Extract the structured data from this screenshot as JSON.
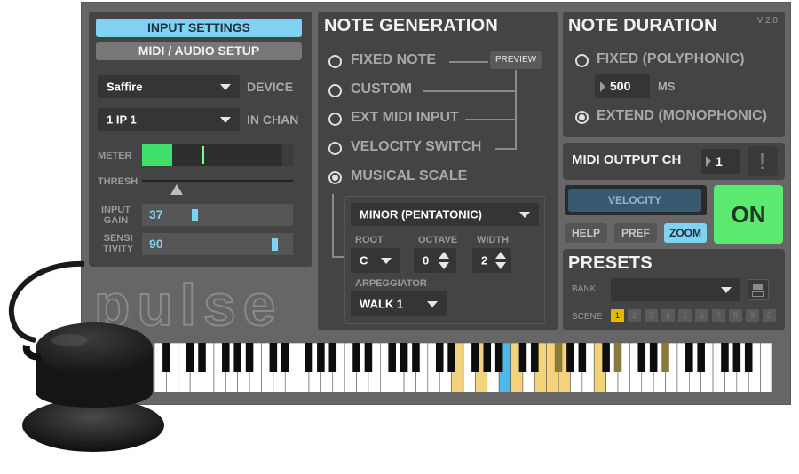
{
  "version": "V 2.0",
  "logo_text": "pulse",
  "input_panel": {
    "tab_input_settings": "INPUT SETTINGS",
    "tab_midi_audio_setup": "MIDI / AUDIO SETUP",
    "device_value": "Saffire",
    "device_label": "DEVICE",
    "in_chan_value": "1 IP 1",
    "in_chan_label": "IN CHAN",
    "meter_label": "METER",
    "meter_level": 0.31,
    "thresh_label": "THRESH",
    "thresh_level": 0.23,
    "input_gain_label_1": "INPUT",
    "input_gain_label_2": "GAIN",
    "input_gain_value": "37",
    "sensitivity_label_1": "SENSI",
    "sensitivity_label_2": "TIVITY",
    "sensitivity_value": "90"
  },
  "note_generation": {
    "title": "NOTE GENERATION",
    "options": [
      {
        "label": "FIXED NOTE",
        "selected": false
      },
      {
        "label": "CUSTOM",
        "selected": false
      },
      {
        "label": "EXT MIDI INPUT",
        "selected": false
      },
      {
        "label": "VELOCITY SWITCH",
        "selected": false
      },
      {
        "label": "MUSICAL SCALE",
        "selected": true
      }
    ],
    "preview_label": "PREVIEW",
    "scale_value": "MINOR (PENTATONIC)",
    "root_label": "ROOT",
    "root_value": "C",
    "octave_label": "OCTAVE",
    "octave_value": "0",
    "width_label": "WIDTH",
    "width_value": "2",
    "arpeggiator_label": "ARPEGGIATOR",
    "arpeggiator_value": "WALK 1"
  },
  "note_duration": {
    "title": "NOTE DURATION",
    "fixed_label": "FIXED (POLYPHONIC)",
    "fixed_selected": false,
    "duration_value": "500",
    "duration_unit": "MS",
    "extend_label": "EXTEND (MONOPHONIC)",
    "extend_selected": true
  },
  "midi_output": {
    "label": "MIDI OUTPUT CH",
    "value": "1",
    "alert_icon_text": "!"
  },
  "controls": {
    "velocity_label": "VELOCITY",
    "on_label": "ON",
    "help_label": "HELP",
    "pref_label": "PREF",
    "zoom_label": "ZOOM"
  },
  "presets": {
    "title": "PRESETS",
    "bank_label": "BANK",
    "bank_value": "",
    "scene_label": "SCENE",
    "scenes": [
      "1",
      "2",
      "3",
      "4",
      "5",
      "6",
      "7",
      "8",
      "9",
      "0"
    ],
    "active_scene": "1"
  },
  "colors": {
    "accent_blue": "#7fd2f2",
    "on_green": "#5bea6f",
    "meter_green": "#3ee06b",
    "scale_highlight": "#f2d27a",
    "active_key": "#4fb8e8",
    "scene_active": "#e6b800"
  },
  "keyboard": {
    "white_key_count": 52,
    "highlighted_white_keys": [
      25,
      27,
      30,
      32,
      33,
      34,
      37
    ],
    "highlighted_black_keys": [
      23,
      27,
      30
    ],
    "active_white_keys": [
      29
    ]
  }
}
